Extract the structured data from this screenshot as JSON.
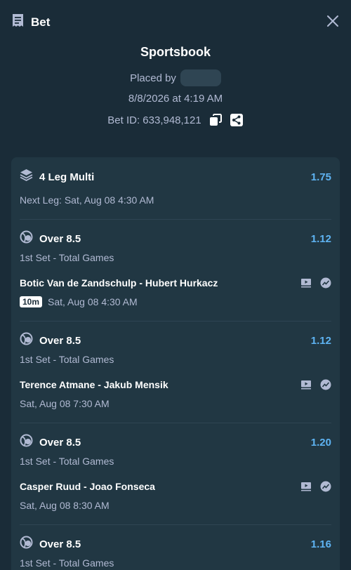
{
  "header": {
    "title": "Bet",
    "icon": "receipt-icon",
    "close_icon": "close-icon"
  },
  "summary": {
    "title": "Sportsbook",
    "placed_by_label": "Placed by",
    "date": "8/8/2026 at 4:19 AM",
    "bet_id": "Bet ID: 633,948,121"
  },
  "multi": {
    "title": "4 Leg Multi",
    "odds": "1.75",
    "next_leg": "Next Leg: Sat, Aug 08 4:30 AM"
  },
  "legs": [
    {
      "selection": "Over 8.5",
      "odds": "1.12",
      "market": "1st Set - Total Games",
      "match": "Botic Van de Zandschulp - Hubert Hurkacz",
      "badge": "10m",
      "time": "Sat, Aug 08  4:30 AM"
    },
    {
      "selection": "Over 8.5",
      "odds": "1.12",
      "market": "1st Set - Total Games",
      "match": "Terence Atmane - Jakub Mensik",
      "time": "Sat, Aug 08  7:30 AM"
    },
    {
      "selection": "Over 8.5",
      "odds": "1.20",
      "market": "1st Set - Total Games",
      "match": "Casper Ruud - Joao Fonseca",
      "time": "Sat, Aug 08  8:30 AM"
    },
    {
      "selection": "Over 8.5",
      "odds": "1.16",
      "market": "1st Set - Total Games"
    }
  ],
  "colors": {
    "background": "#1a2c38",
    "card": "#213743",
    "odds": "#5eb3f2",
    "muted": "#b1bad3"
  }
}
